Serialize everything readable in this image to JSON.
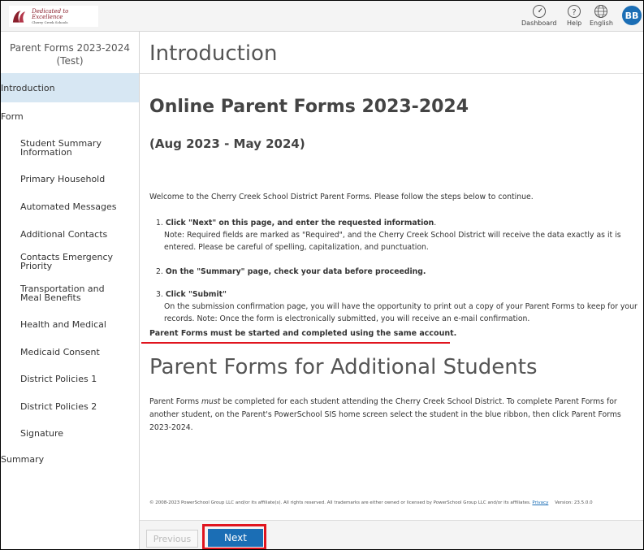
{
  "header": {
    "logo_title": "Dedicated to Excellence",
    "logo_subtitle": "Cherry Creek Schools",
    "dashboard_label": "Dashboard",
    "help_label": "Help",
    "language_label": "English",
    "avatar_initials": "BB",
    "accent_color": "#1b6eb5"
  },
  "sidebar": {
    "form_title_line1": "Parent Forms 2023-2024",
    "form_title_line2": "(Test)",
    "items": [
      {
        "label": "Introduction",
        "level": "top",
        "active": true
      },
      {
        "label": "Form",
        "level": "top"
      },
      {
        "label": "Student Summary Information",
        "level": "sub"
      },
      {
        "label": "Primary Household",
        "level": "sub"
      },
      {
        "label": "Automated Messages",
        "level": "sub"
      },
      {
        "label": "Additional Contacts",
        "level": "sub"
      },
      {
        "label": "Contacts Emergency Priority",
        "level": "sub"
      },
      {
        "label": "Transportation and Meal Benefits",
        "level": "sub"
      },
      {
        "label": "Health and Medical",
        "level": "sub"
      },
      {
        "label": "Medicaid Consent",
        "level": "sub"
      },
      {
        "label": "District Policies 1",
        "level": "sub"
      },
      {
        "label": "District Policies 2",
        "level": "sub"
      },
      {
        "label": "Signature",
        "level": "sub"
      },
      {
        "label": "Summary",
        "level": "top"
      }
    ]
  },
  "main": {
    "page_title": "Introduction",
    "heading": "Online Parent Forms 2023-2024",
    "subheading": "(Aug 2023 - May 2024)",
    "welcome": "Welcome to the Cherry Creek School District Parent Forms. Please follow the steps below to continue.",
    "steps": [
      {
        "num": "1.",
        "title": "Click \"Next\" on this page, and enter the requested information",
        "suffix": ".",
        "note": "Note: Required fields are marked as \"Required\", and the Cherry Creek School District will receive the data exactly as it is entered. Please be careful of spelling, capitalization, and punctuation."
      },
      {
        "num": "2.",
        "title": "On the \"Summary\" page, check your data before proceeding.",
        "suffix": "",
        "note": ""
      },
      {
        "num": "3.",
        "title": "Click \"Submit\"",
        "suffix": "",
        "note": "On the submission confirmation page, you will have the opportunity to print out a copy of your Parent Forms to keep for your records. Note: Once the form is electronically submitted, you will receive an e-mail confirmation."
      }
    ],
    "warning": "Parent Forms must be started and completed using the same account.",
    "additional_heading": "Parent Forms for Additional Students",
    "additional_pre": "Parent Forms ",
    "additional_em": "must",
    "additional_post": " be completed for each student attending the Cherry Creek School District. To complete Parent Forms for another student, on the Parent's PowerSchool SIS home screen select the student in the blue ribbon, then click Parent Forms 2023-2024."
  },
  "footer": {
    "copyright": "© 2008-2023 PowerSchool Group LLC and/or its affiliate(s). All rights reserved. All trademarks are either owned or licensed by PowerSchool Group LLC and/or its affiliates.",
    "privacy_label": "Privacy",
    "version": "Version: 23.5.0.0"
  },
  "buttons": {
    "previous_label": "Previous",
    "next_label": "Next",
    "highlight_color": "#e0141e"
  }
}
